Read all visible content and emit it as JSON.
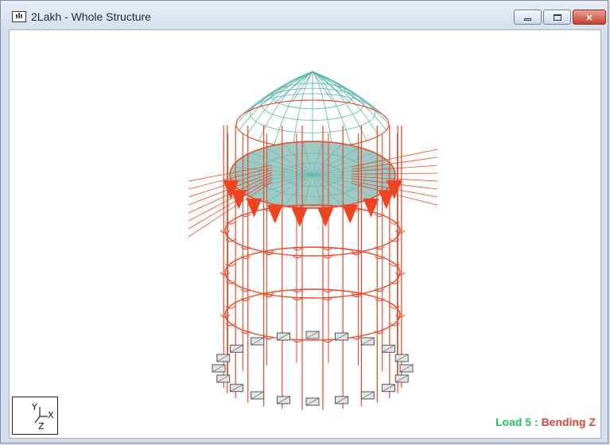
{
  "window": {
    "title": "2Lakh - Whole Structure",
    "app_icon_text": "ılı",
    "buttons": {
      "minimize": "minimize",
      "maximize": "maximize",
      "close": "×"
    }
  },
  "view": {
    "load_label": "Load 5",
    "separator": " : ",
    "result_type": "Bending Z",
    "triad": {
      "y": "Y",
      "x": "X",
      "z": "Z"
    }
  },
  "colors": {
    "bending_diagram": "#ee4422",
    "mesh": "#5ab5ac",
    "support": "#555555",
    "status_green": "#22c55e",
    "status_red": "#d9453a"
  }
}
